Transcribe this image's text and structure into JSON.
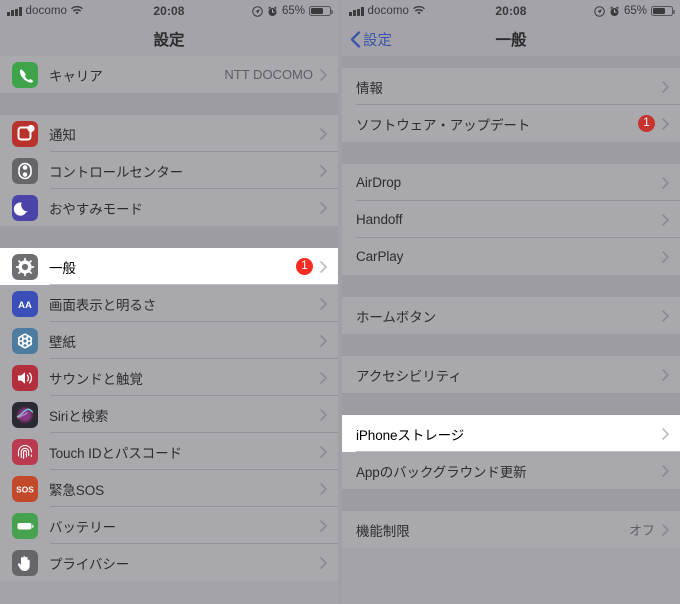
{
  "status_bar": {
    "carrier": "docomo",
    "time": "20:08",
    "battery_percent": "65%",
    "icons": [
      "signal-bars-icon",
      "wifi-icon",
      "location-arrow-icon",
      "alarm-clock-icon",
      "battery-icon"
    ]
  },
  "colors": {
    "badge_red": "#c7332e",
    "link_blue": "#3b54a8",
    "panel_bg": "#a3a3a9",
    "group_bg": "#a8a8ad",
    "highlight_bg": "#ffffff"
  },
  "left_panel": {
    "nav_title": "設定",
    "groups": [
      {
        "rows": [
          {
            "label": "キャリア",
            "value": "NTT DOCOMO",
            "icon": "phone-icon",
            "icon_color": "#3fa34a",
            "badge": "",
            "highlight": false
          }
        ]
      },
      {
        "rows": [
          {
            "label": "通知",
            "value": "",
            "icon": "notifications-icon",
            "icon_color": "#b8332c",
            "badge": "",
            "highlight": false
          },
          {
            "label": "コントロールセンター",
            "value": "",
            "icon": "control-center-icon",
            "icon_color": "#65656a",
            "badge": "",
            "highlight": false
          },
          {
            "label": "おやすみモード",
            "value": "",
            "icon": "moon-icon",
            "icon_color": "#4b44a8",
            "badge": "",
            "highlight": false
          }
        ]
      },
      {
        "rows": [
          {
            "label": "一般",
            "value": "",
            "icon": "gear-icon",
            "icon_color": "#6e6e73",
            "badge": "1",
            "highlight": true
          },
          {
            "label": "画面表示と明るさ",
            "value": "",
            "icon": "display-brightness-icon",
            "icon_color": "#3b4fb8",
            "badge": "",
            "highlight": false
          },
          {
            "label": "壁紙",
            "value": "",
            "icon": "wallpaper-icon",
            "icon_color": "#4d7ca0",
            "badge": "",
            "highlight": false
          },
          {
            "label": "サウンドと触覚",
            "value": "",
            "icon": "speaker-icon",
            "icon_color": "#b32f3e",
            "badge": "",
            "highlight": false
          },
          {
            "label": "Siriと検索",
            "value": "",
            "icon": "siri-icon",
            "icon_color": "#2a2a33",
            "badge": "",
            "highlight": false
          },
          {
            "label": "Touch IDとパスコード",
            "value": "",
            "icon": "fingerprint-icon",
            "icon_color": "#bb3a50",
            "badge": "",
            "highlight": false
          },
          {
            "label": "緊急SOS",
            "value": "",
            "icon": "sos-icon",
            "icon_color": "#c2492a",
            "badge": "",
            "highlight": false
          },
          {
            "label": "バッテリー",
            "value": "",
            "icon": "battery-icon",
            "icon_color": "#46a24f",
            "badge": "",
            "highlight": false
          },
          {
            "label": "プライバシー",
            "value": "",
            "icon": "privacy-hand-icon",
            "icon_color": "#65656a",
            "badge": "",
            "highlight": false
          }
        ]
      }
    ]
  },
  "right_panel": {
    "nav_title": "一般",
    "back_label": "設定",
    "groups": [
      {
        "rows": [
          {
            "label": "情報",
            "value": "",
            "badge": "",
            "highlight": false
          },
          {
            "label": "ソフトウェア・アップデート",
            "value": "",
            "badge": "1",
            "highlight": false
          }
        ]
      },
      {
        "rows": [
          {
            "label": "AirDrop",
            "value": "",
            "badge": "",
            "highlight": false
          },
          {
            "label": "Handoff",
            "value": "",
            "badge": "",
            "highlight": false
          },
          {
            "label": "CarPlay",
            "value": "",
            "badge": "",
            "highlight": false
          }
        ]
      },
      {
        "rows": [
          {
            "label": "ホームボタン",
            "value": "",
            "badge": "",
            "highlight": false
          }
        ]
      },
      {
        "rows": [
          {
            "label": "アクセシビリティ",
            "value": "",
            "badge": "",
            "highlight": false
          }
        ]
      },
      {
        "rows": [
          {
            "label": "iPhoneストレージ",
            "value": "",
            "badge": "",
            "highlight": true
          },
          {
            "label": "Appのバックグラウンド更新",
            "value": "",
            "badge": "",
            "highlight": false
          }
        ]
      },
      {
        "rows": [
          {
            "label": "機能制限",
            "value": "オフ",
            "badge": "",
            "highlight": false
          }
        ]
      }
    ]
  }
}
